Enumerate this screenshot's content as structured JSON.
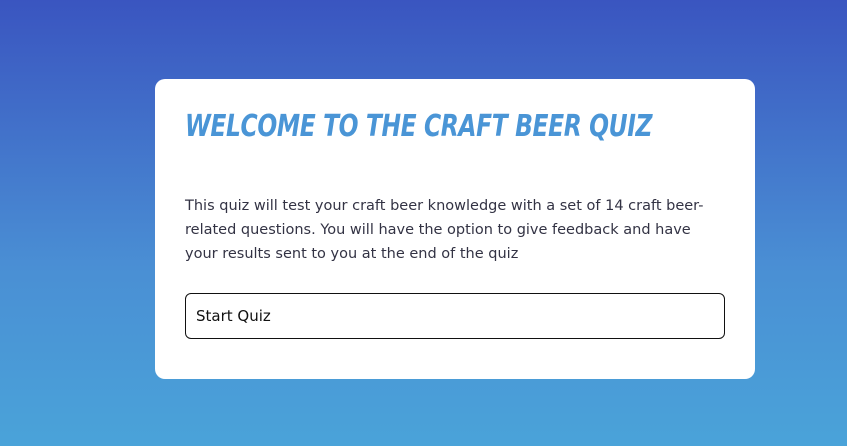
{
  "quiz": {
    "title": "Welcome to the Craft Beer Quiz",
    "description": "This quiz will test your craft beer knowledge with a set of 14 craft beer-related questions. You will have the option to give feedback and have your results sent to you at the end of the quiz",
    "start_button_label": "Start Quiz"
  },
  "colors": {
    "background_top": "#3a55c0",
    "background_bottom": "#4aa3d9",
    "title": "#4a95d6",
    "card": "#ffffff"
  }
}
